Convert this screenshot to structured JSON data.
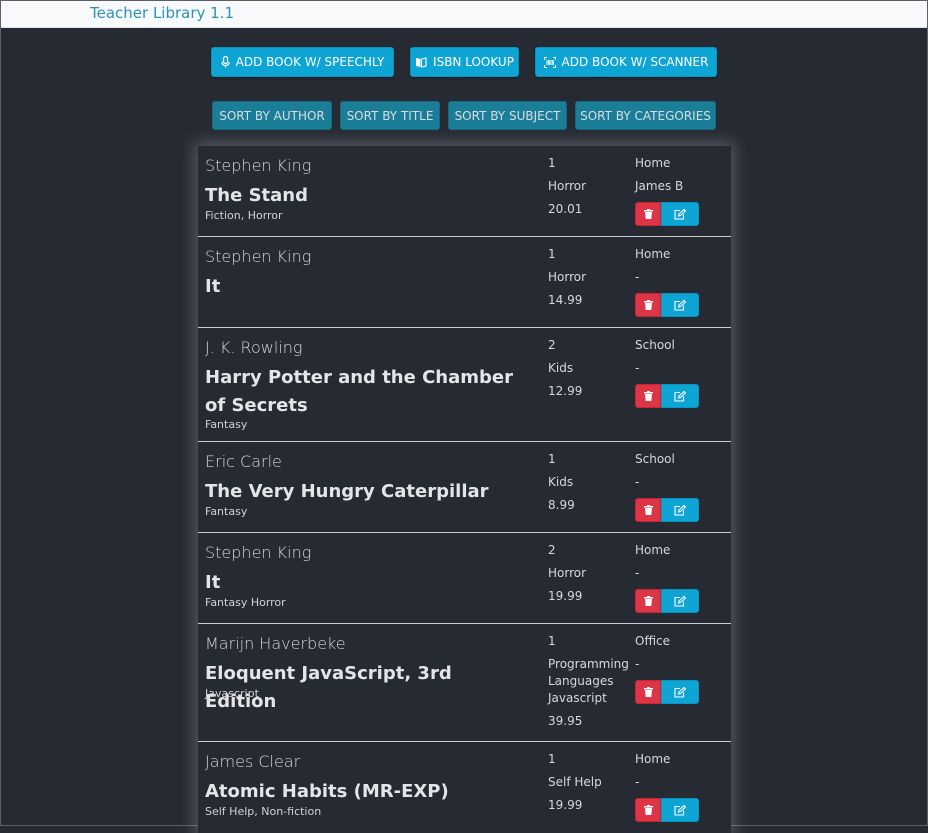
{
  "app": {
    "title": "Teacher Library 1.1"
  },
  "toolbar": {
    "speechly": "ADD BOOK W/ SPEECHLY",
    "isbn": "ISBN LOOKUP",
    "scanner": "ADD BOOK W/ SCANNER"
  },
  "sort": {
    "author": "SORT BY AUTHOR",
    "title": "SORT BY TITLE",
    "subject": "SORT BY SUBJECT",
    "categories": "SORT BY CATEGORIES"
  },
  "books": [
    {
      "author": "Stephen King",
      "title": "The Stand",
      "subject": "Fiction, Horror",
      "qty": "1",
      "category": [
        "Horror"
      ],
      "price": "20.01",
      "location": "Home",
      "borrower": "James B"
    },
    {
      "author": "Stephen King",
      "title": "It",
      "subject": "",
      "qty": "1",
      "category": [
        "Horror"
      ],
      "price": "14.99",
      "location": "Home",
      "borrower": "-"
    },
    {
      "author": "J. K. Rowling",
      "title": "Harry Potter and the Chamber of Secrets",
      "subject": "Fantasy",
      "qty": "2",
      "category": [
        "Kids"
      ],
      "price": "12.99",
      "location": "School",
      "borrower": "-"
    },
    {
      "author": "Eric Carle",
      "title": "The Very Hungry Caterpillar",
      "subject": "Fantasy",
      "qty": "1",
      "category": [
        "Kids"
      ],
      "price": "8.99",
      "location": "School",
      "borrower": "-"
    },
    {
      "author": "Stephen King",
      "title": "It",
      "subject": "Fantasy Horror",
      "qty": "2",
      "category": [
        "Horror"
      ],
      "price": "19.99",
      "location": "Home",
      "borrower": "-"
    },
    {
      "author": "Marijn Haverbeke",
      "title": "Eloquent JavaScript, 3rd Edition",
      "subject": "Javascript",
      "qty": "1",
      "category": [
        "Programming",
        "Languages",
        "Javascript"
      ],
      "price": "39.95",
      "location": "Office",
      "borrower": "-"
    },
    {
      "author": "James Clear",
      "title": "Atomic Habits (MR-EXP)",
      "subject": "Self Help, Non-fiction",
      "qty": "1",
      "category": [
        "Self Help"
      ],
      "price": "19.99",
      "location": "Home",
      "borrower": "-"
    }
  ]
}
